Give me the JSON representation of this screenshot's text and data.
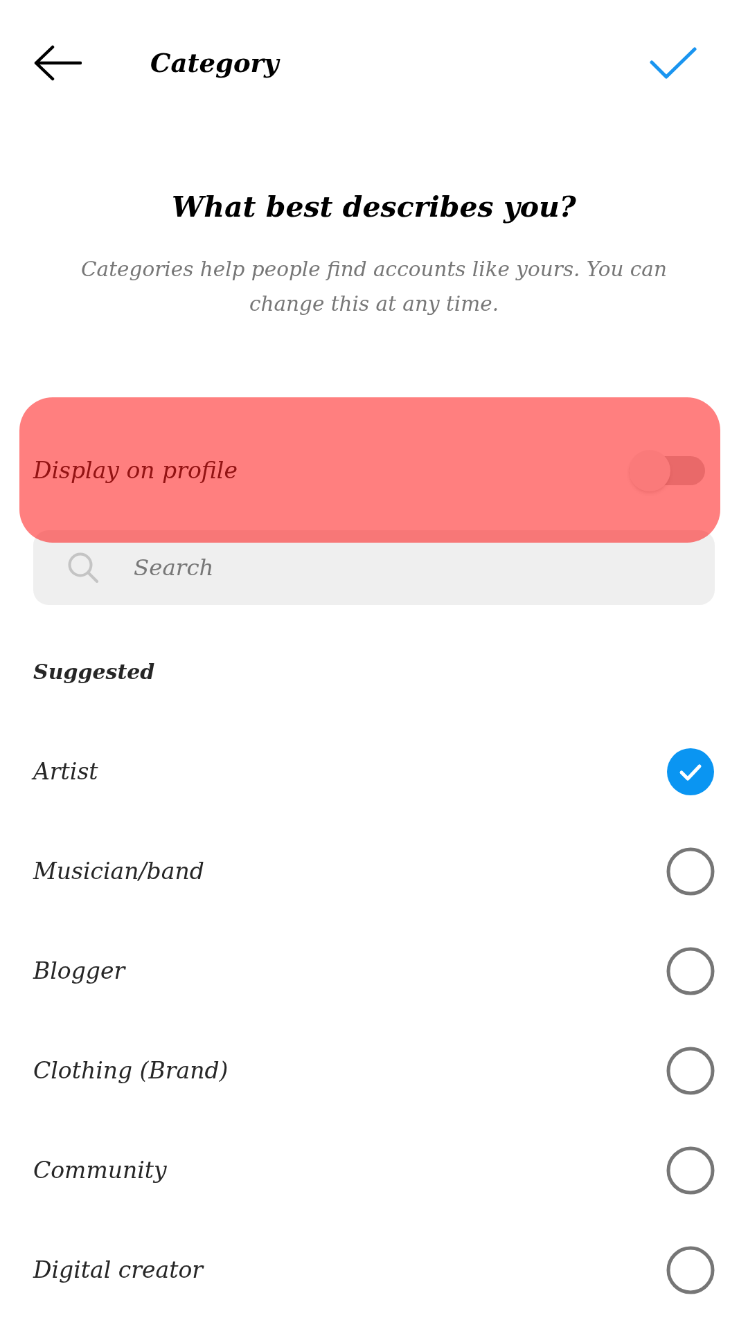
{
  "header": {
    "title": "Category"
  },
  "intro": {
    "heading": "What best describes you?",
    "description": "Categories help people find accounts like yours. You can change this at any time."
  },
  "display_on_profile": {
    "label": "Display on profile",
    "on": false,
    "highlighted": true
  },
  "search": {
    "placeholder": "Search"
  },
  "section_title": "Suggested",
  "categories": [
    {
      "label": "Artist",
      "selected": true
    },
    {
      "label": "Musician/band",
      "selected": false
    },
    {
      "label": "Blogger",
      "selected": false
    },
    {
      "label": "Clothing (Brand)",
      "selected": false
    },
    {
      "label": "Community",
      "selected": false
    },
    {
      "label": "Digital creator",
      "selected": false
    }
  ]
}
